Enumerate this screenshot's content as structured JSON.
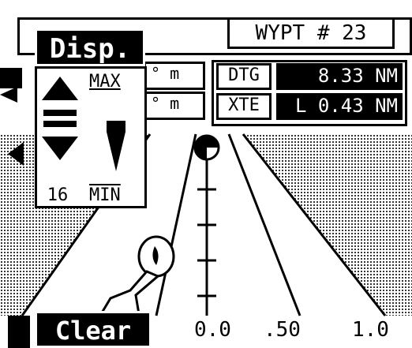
{
  "header": {
    "waypoint": "WYPT # 23"
  },
  "units": {
    "row1": "° m",
    "row2": "° m"
  },
  "data": {
    "dtg_label": "DTG",
    "dtg_value": "8.33 NM",
    "xte_label": "XTE",
    "xte_value": "L 0.43 NM"
  },
  "sensitivity": {
    "max_label": "MAX",
    "min_label": "MIN",
    "level": "16"
  },
  "buttons": {
    "disp": "Disp.",
    "clear": "Clear"
  },
  "scale": {
    "zero": "0.0",
    "half": ".50",
    "one": "1.0"
  },
  "icons": [
    "arrow-up-icon",
    "arrow-down-icon",
    "equals-icon",
    "level-wedge-icon",
    "boat-icon",
    "destination-icon"
  ]
}
